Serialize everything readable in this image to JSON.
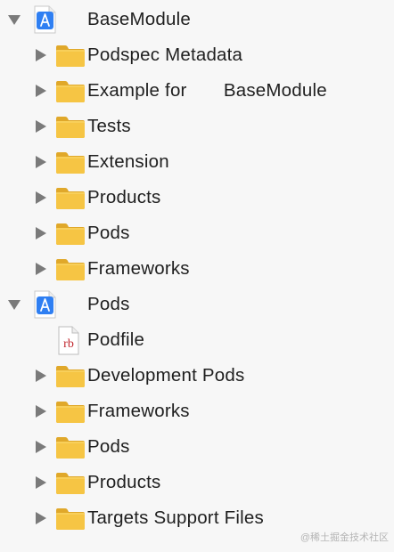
{
  "tree": [
    {
      "label": "BaseModule",
      "icon": "xcode-project-icon",
      "level": 0,
      "expanded": true
    },
    {
      "label": "Podspec Metadata",
      "icon": "folder-icon",
      "level": 1,
      "expanded": false
    },
    {
      "label": "Example for       BaseModule",
      "icon": "folder-icon",
      "level": 1,
      "expanded": false
    },
    {
      "label": "Tests",
      "icon": "folder-icon",
      "level": 1,
      "expanded": false
    },
    {
      "label": "Extension",
      "icon": "folder-icon",
      "level": 1,
      "expanded": false
    },
    {
      "label": "Products",
      "icon": "folder-icon",
      "level": 1,
      "expanded": false
    },
    {
      "label": "Pods",
      "icon": "folder-icon",
      "level": 1,
      "expanded": false
    },
    {
      "label": "Frameworks",
      "icon": "folder-icon",
      "level": 1,
      "expanded": false
    },
    {
      "label": "Pods",
      "icon": "xcode-project-icon",
      "level": 0,
      "expanded": true
    },
    {
      "label": "Podfile",
      "icon": "ruby-file-icon",
      "level": 1,
      "expanded": null
    },
    {
      "label": "Development Pods",
      "icon": "folder-icon",
      "level": 1,
      "expanded": false
    },
    {
      "label": "Frameworks",
      "icon": "folder-icon",
      "level": 1,
      "expanded": false
    },
    {
      "label": "Pods",
      "icon": "folder-icon",
      "level": 1,
      "expanded": false
    },
    {
      "label": "Products",
      "icon": "folder-icon",
      "level": 1,
      "expanded": false
    },
    {
      "label": "Targets Support Files",
      "icon": "folder-icon",
      "level": 1,
      "expanded": false
    }
  ],
  "colors": {
    "background": "#f7f7f7",
    "text": "#1f1f1f",
    "disclosure": "#7a7a7a",
    "folder": "#f6c544",
    "project": "#2f7ff2",
    "ruby": "#c0262d"
  },
  "watermark": "@稀土掘金技术社区"
}
